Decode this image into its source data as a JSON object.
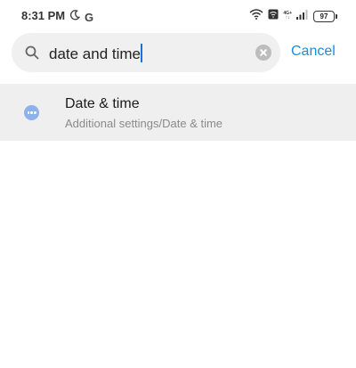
{
  "status_bar": {
    "time": "8:31 PM",
    "g_letter": "G",
    "network_top": "4G+",
    "network_bottom": "↑↓",
    "battery": "97",
    "icons": [
      "moon-icon",
      "google-icon",
      "wifi-icon",
      "vowifi-icon",
      "signal-icon",
      "battery-icon"
    ]
  },
  "search": {
    "query": "date and time",
    "cancel_label": "Cancel",
    "accent_color": "#1a8ed8"
  },
  "results": [
    {
      "title": "Date & time",
      "subtitle": "Additional settings/Date & time",
      "icon": "more-icon",
      "icon_color": "#8fb1ea"
    }
  ]
}
